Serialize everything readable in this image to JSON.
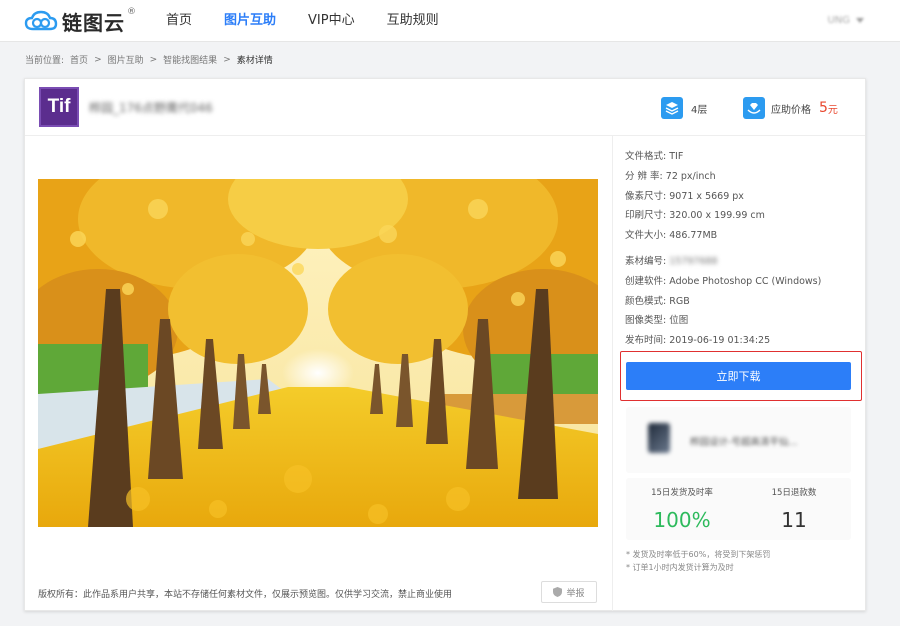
{
  "header": {
    "logo_text": "链图云",
    "logo_reg": "®",
    "nav": [
      "首页",
      "图片互助",
      "VIP中心",
      "互助规则"
    ],
    "active_nav_index": 1,
    "user": "UNG"
  },
  "breadcrumb": {
    "prefix": "当前位置:",
    "items": [
      "首页",
      ">",
      "图片互助",
      ">",
      "智能找图结果",
      ">"
    ],
    "current": "素材详情"
  },
  "file": {
    "format_badge": "Tif",
    "title": "桦园_176点野鹰代046",
    "layers": "4层",
    "price_label": "应助价格",
    "price": "5",
    "price_unit": "元"
  },
  "info": {
    "rows_a": [
      {
        "label": "文件格式:",
        "value": "TIF"
      },
      {
        "label": "分 辨 率:",
        "value": "72 px/inch"
      },
      {
        "label": "像素尺寸:",
        "value": "9071 x 5669 px"
      },
      {
        "label": "印刷尺寸:",
        "value": "320.00 x 199.99 cm"
      },
      {
        "label": "文件大小:",
        "value": "486.77MB"
      }
    ],
    "material_id_label": "素材编号:",
    "material_id": "15797688",
    "rows_b": [
      {
        "label": "创建软件:",
        "value": "Adobe Photoshop CC (Windows)"
      },
      {
        "label": "颜色模式:",
        "value": "RGB"
      },
      {
        "label": "图像类型:",
        "value": "位图"
      },
      {
        "label": "发布时间:",
        "value": "2019-06-19 01:34:25"
      }
    ]
  },
  "download_label": "立即下载",
  "seller_name": "桦园设计-号超高清平仙...",
  "stats": {
    "ship_label": "15日发货及时率",
    "ship_value": "100%",
    "refund_label": "15日退款数",
    "refund_value": "11"
  },
  "notes": [
    "* 发货及时率低于60%，将受到下架惩罚",
    "* 订单1小时内发货计算为及时"
  ],
  "copyright": "版权所有：此作品系用户共享，本站不存储任何素材文件，仅展示预览图。仅供学习交流，禁止商业使用",
  "report_label": "举报",
  "colors": {
    "accent": "#2c7ef8",
    "price": "#e8472e",
    "green": "#2dba5c",
    "frame": "#e03030"
  }
}
